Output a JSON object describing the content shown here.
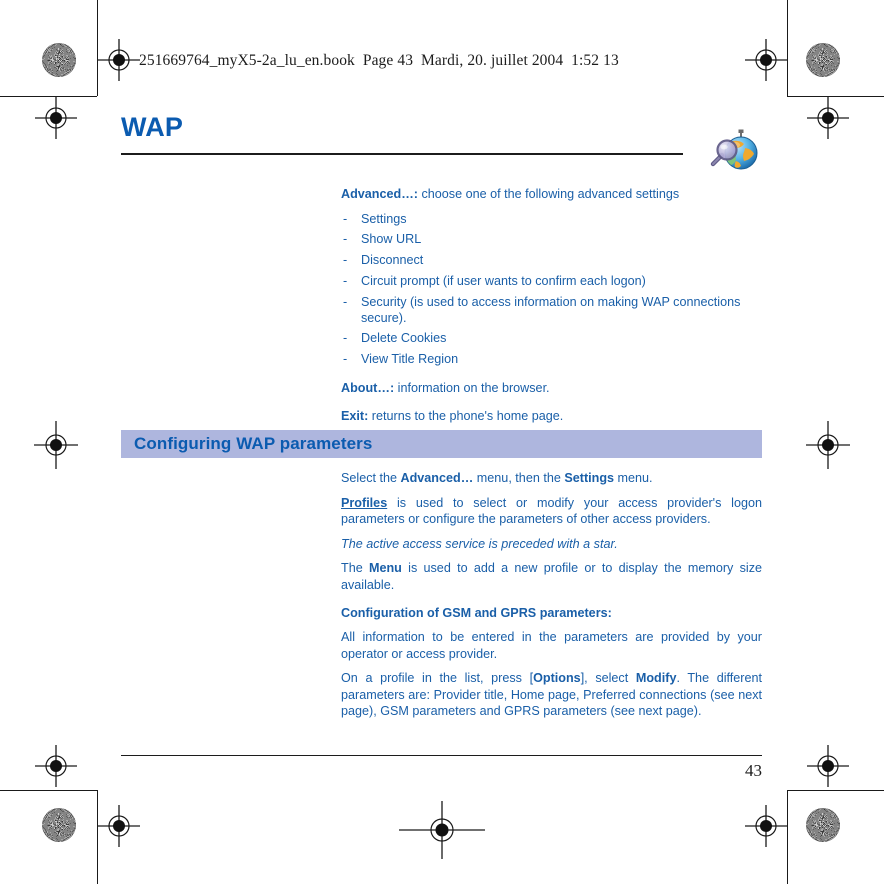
{
  "document": {
    "header_line": "251669764_myX5-2a_lu_en.book  Page 43  Mardi, 20. juillet 2004  1:52 13",
    "chapter_title": "WAP",
    "chapter_icon": "globe-magnifier-icon",
    "page_number": "43",
    "accent_color": "#1a5fa8",
    "title_color": "#0b5bb0",
    "banner_color": "#aeb6de"
  },
  "advanced": {
    "lead_bold": "Advanced…:",
    "lead_rest": " choose one of the following advanced settings",
    "items": [
      "Settings",
      "Show URL",
      "Disconnect",
      "Circuit prompt (if user wants to confirm each logon)",
      "Security (is used to access information on making WAP connections secure).",
      "Delete Cookies",
      "View Title Region"
    ],
    "dash": "-"
  },
  "about": {
    "bold": "About…:",
    "rest": " information on the browser."
  },
  "exit": {
    "bold": "Exit:",
    "rest": " returns to the phone's home page."
  },
  "section": {
    "title": "Configuring WAP parameters"
  },
  "body": {
    "p1_a": "Select the ",
    "p1_b": "Advanced…",
    "p1_c": " menu, then the ",
    "p1_d": "Settings",
    "p1_e": " menu.",
    "p2_a": "Profiles",
    "p2_b": " is used to select or modify your access provider's logon parameters or configure the parameters of other access providers.",
    "p3": "The active access service is preceded with a star.",
    "p4_a": "The ",
    "p4_b": "Menu",
    "p4_c": " is used to add a new profile or to display the memory size available.",
    "p5": "Configuration of GSM and GPRS parameters:",
    "p6": "All information to be entered in the parameters are provided by your operator or access provider.",
    "p7_a": "On a profile in the list, press [",
    "p7_b": "Options",
    "p7_c": "], select ",
    "p7_d": "Modify",
    "p7_e": ". The different parameters are: Provider title, Home page, Preferred connections (see next page), GSM parameters and GPRS parameters (see next page)."
  }
}
